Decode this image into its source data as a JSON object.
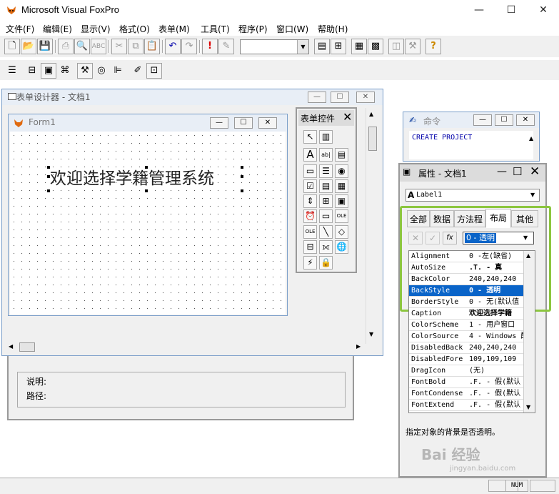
{
  "app": {
    "title": "Microsoft Visual FoxPro",
    "minimize": "—",
    "maximize": "☐",
    "close": "✕"
  },
  "menu": [
    "文件(F)",
    "编辑(E)",
    "显示(V)",
    "格式(O)",
    "表单(M)",
    "工具(T)",
    "程序(P)",
    "窗口(W)",
    "帮助(H)"
  ],
  "toolbar1": {
    "buttons": [
      "new-icon",
      "open-icon",
      "save-icon",
      "print-icon",
      "print-preview-icon",
      "spell-check-icon",
      "cut-icon",
      "copy-icon",
      "paste-icon",
      "undo-icon",
      "redo-icon",
      "run-icon",
      "modify-icon"
    ],
    "combo_value": "",
    "buttons2": [
      "command-window-icon",
      "data-session-icon",
      "form-wizard-icon",
      "report-wizard-icon",
      "database-icon",
      "build-icon",
      "help-icon"
    ]
  },
  "form_designer": {
    "title": "表单设计器 - 文档1",
    "form_title": "Form1",
    "label_text": "欢迎选择学籍管理系统"
  },
  "controls_palette": {
    "title": "表单控件",
    "close": "✕"
  },
  "command_window": {
    "title": "命令",
    "text": "CREATE PROJECT"
  },
  "properties": {
    "title": "属性 - 文档1",
    "object": "Label1",
    "tabs": [
      "全部",
      "数据",
      "方法程",
      "布局",
      "其他"
    ],
    "active_tab": "布局",
    "value_box": "0 - 透明",
    "rows": [
      {
        "name": "Alignment",
        "value": "0 -左(缺省)"
      },
      {
        "name": "AutoSize",
        "value": ".T. - 真"
      },
      {
        "name": "BackColor",
        "value": "240,240,240"
      },
      {
        "name": "BackStyle",
        "value": "0 - 透明"
      },
      {
        "name": "BorderStyle",
        "value": "0 - 无(默认值"
      },
      {
        "name": "Caption",
        "value": "欢迎选择学籍"
      },
      {
        "name": "ColorScheme",
        "value": "1 - 用户窗口"
      },
      {
        "name": "ColorSource",
        "value": "4 - Windows 配"
      },
      {
        "name": "DisabledBack",
        "value": "240,240,240"
      },
      {
        "name": "DisabledFore",
        "value": "109,109,109"
      },
      {
        "name": "DragIcon",
        "value": "(无)"
      },
      {
        "name": "FontBold",
        "value": ".F. - 假(默认"
      },
      {
        "name": "FontCondense",
        "value": ".F. - 假(默认"
      },
      {
        "name": "FontExtend",
        "value": ".F. - 假(默认"
      }
    ],
    "selected_row": 3,
    "description": "指定对象的背景是否透明。"
  },
  "project_info": {
    "desc_label": "说明:",
    "path_label": "路径:"
  },
  "status": {
    "num": "NUM"
  },
  "watermark": {
    "brand": "Bai 经验",
    "url": "jingyan.baidu.com"
  },
  "colors": {
    "highlight": "#0a64c8",
    "green_box": "#8cc63f",
    "window_border": "#7a9ec9"
  }
}
